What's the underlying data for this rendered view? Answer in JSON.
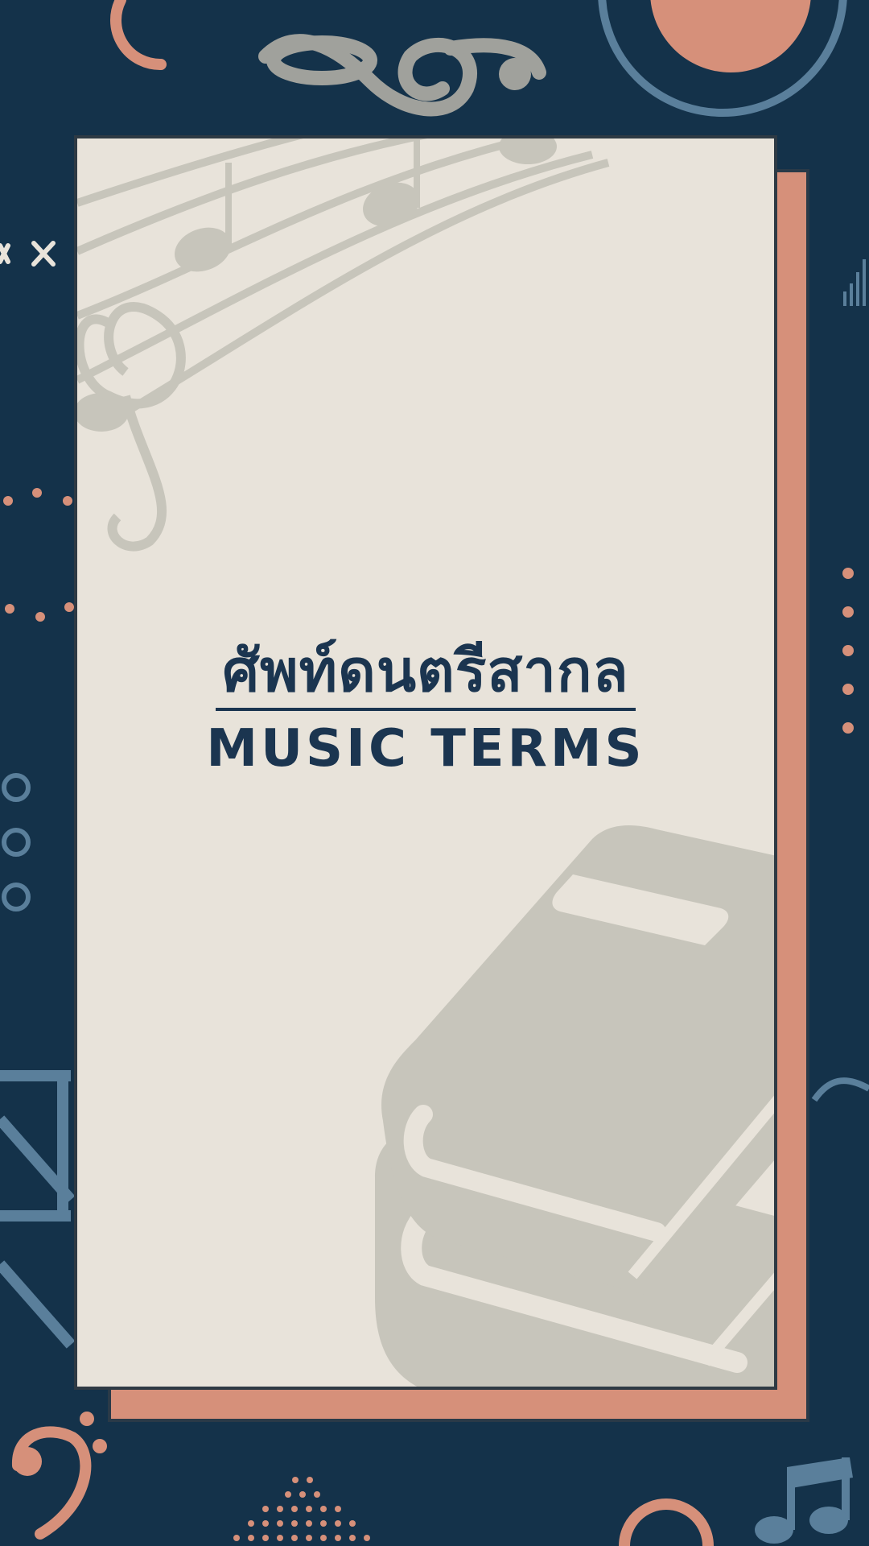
{
  "title": {
    "thai": "ศัพท์ดนตรีสากล",
    "english": "MUSIC TERMS"
  },
  "colors": {
    "background": "#14324a",
    "card": "#e8e3da",
    "accent": "#d6907a",
    "text": "#1b3550",
    "blue_decor": "#5a7f9b",
    "gray_decor": "#a0a19c"
  },
  "icons": [
    "treble-clef-icon",
    "bass-clef-icon",
    "music-notes-icon",
    "books-icon",
    "double-note-icon"
  ]
}
